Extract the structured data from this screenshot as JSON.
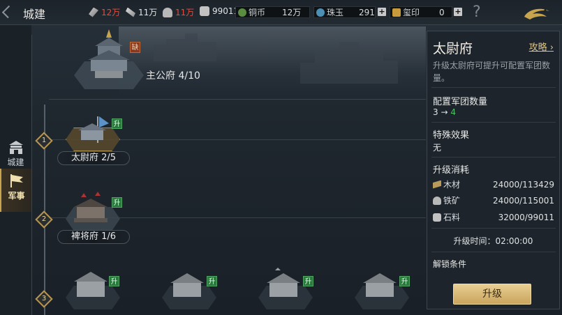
{
  "header": {
    "title": "城建"
  },
  "resources": [
    {
      "icon": "feather-icon",
      "value": "12万",
      "color": "#e84b3c"
    },
    {
      "icon": "scroll-icon",
      "value": "11万",
      "color": "#dfe4e6"
    },
    {
      "icon": "ore-icon",
      "value": "11万",
      "color": "#e84b3c"
    },
    {
      "icon": "stone-icon",
      "value": "99011",
      "color": "#dfe4e6"
    }
  ],
  "currencies": {
    "copper": {
      "label": "铜币",
      "value": "12万"
    },
    "jade": {
      "label": "珠玉",
      "value": "291"
    },
    "seal": {
      "label": "玺印",
      "value": "0"
    }
  },
  "help": "?",
  "plus": "+",
  "nav": [
    {
      "label": "城建",
      "active": false
    },
    {
      "label": "军事",
      "active": true
    }
  ],
  "tiers": [
    "1",
    "2",
    "3"
  ],
  "buildings": {
    "main": {
      "label": "主公府 4/10",
      "badge": "缺"
    },
    "taiwei": {
      "label": "太尉府 2/5",
      "badge": "升"
    },
    "pijiang": {
      "label": "裨将府 1/6",
      "badge": "升"
    },
    "tier3_badges": [
      "升",
      "升",
      "升",
      "升"
    ]
  },
  "panel": {
    "title": "太尉府",
    "guide_link": "攻略",
    "description": "升级太尉府可提升可配置军团数量。",
    "legion_heading": "配置军团数量",
    "legion_from": "3",
    "legion_arrow": "→",
    "legion_to": "4",
    "effect_heading": "特殊效果",
    "effect_value": "无",
    "cost_heading": "升级消耗",
    "costs": [
      {
        "icon": "wood-icon",
        "name": "木材",
        "value": "24000/113429"
      },
      {
        "icon": "iron-icon",
        "name": "铁矿",
        "value": "24000/115001"
      },
      {
        "icon": "stone-icon",
        "name": "石料",
        "value": "32000/99011"
      }
    ],
    "time_label": "升级时间：02:00:00",
    "unlock_heading": "解锁条件",
    "upgrade_button": "升级"
  }
}
